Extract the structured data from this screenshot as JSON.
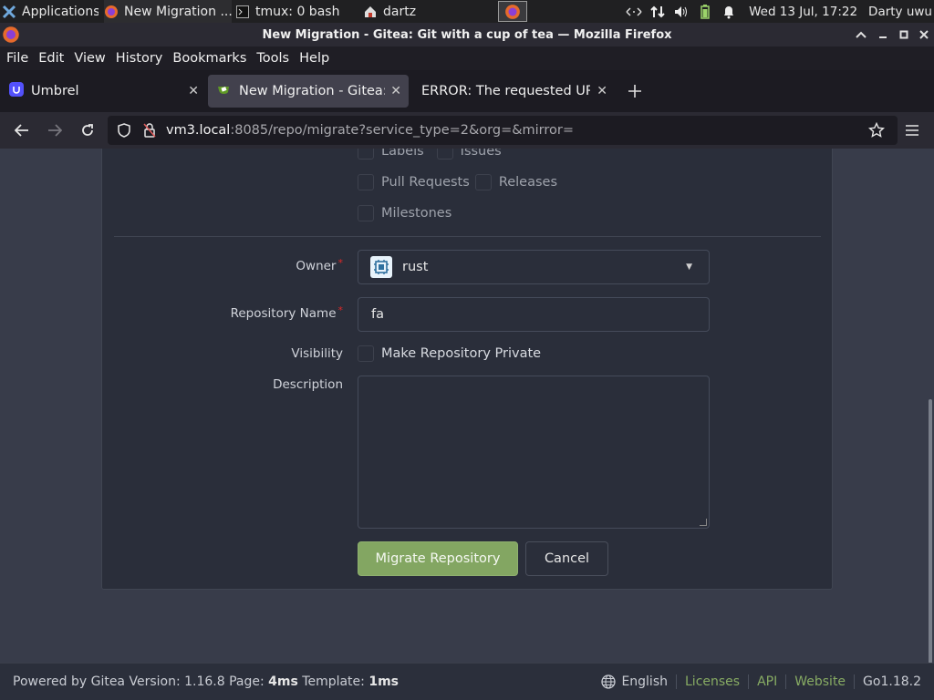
{
  "taskbar": {
    "apps_label": "Applications",
    "tasks": [
      {
        "label": "New Migration ..."
      },
      {
        "label": "tmux: 0 bash"
      },
      {
        "label": "dartz"
      }
    ],
    "clock": "Wed 13 Jul, 17:22",
    "user": "Darty uwu"
  },
  "window": {
    "title": "New Migration - Gitea: Git with a cup of tea — Mozilla Firefox"
  },
  "menubar": [
    "File",
    "Edit",
    "View",
    "History",
    "Bookmarks",
    "Tools",
    "Help"
  ],
  "tabs": [
    {
      "label": "Umbrel",
      "active": false
    },
    {
      "label": "New Migration - Gitea: Git",
      "active": true
    },
    {
      "label": "ERROR: The requested URL",
      "active": false
    }
  ],
  "navbar": {
    "url_host": "vm3.local",
    "url_rest": ":8085/repo/migrate?service_type=2&org=&mirror="
  },
  "form": {
    "migrate_items": {
      "labels": "Labels",
      "issues": "Issues",
      "pull_requests": "Pull Requests",
      "releases": "Releases",
      "milestones": "Milestones"
    },
    "owner_label": "Owner",
    "owner_value": "rust",
    "repo_name_label": "Repository Name",
    "repo_name_value": "fa",
    "visibility_label": "Visibility",
    "private_label": "Make Repository Private",
    "description_label": "Description",
    "description_value": "",
    "required_mark": "*",
    "submit_label": "Migrate Repository",
    "cancel_label": "Cancel"
  },
  "footer": {
    "powered": "Powered by Gitea Version: 1.16.8 Page: ",
    "page_time": "4ms",
    "template_text": " Template: ",
    "template_time": "1ms",
    "language": "English",
    "licenses": "Licenses",
    "api": "API",
    "website": "Website",
    "go_version": "Go1.18.2"
  },
  "colors": {
    "primary_button": "#83a662",
    "link": "#87ab63",
    "required": "#db2828"
  }
}
